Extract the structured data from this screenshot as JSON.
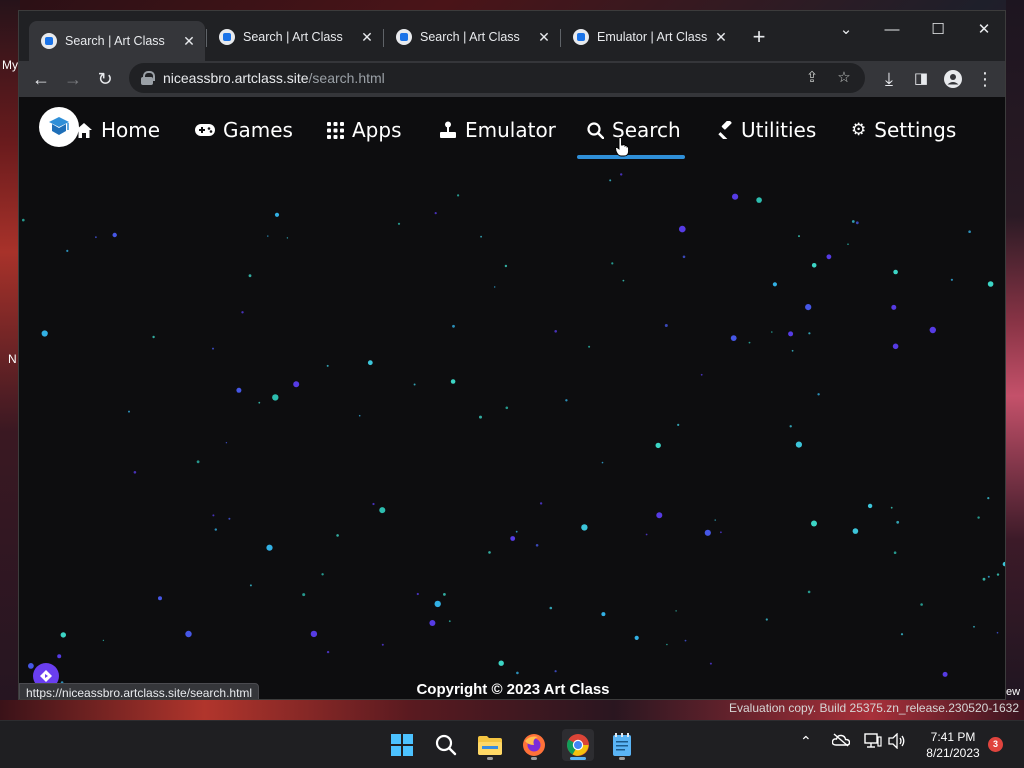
{
  "desktop": {
    "left_label_top": "My",
    "left_label_mid": "N",
    "right_label": "ew",
    "watermark": "Evaluation copy. Build 25375.zn_release.230520-1632"
  },
  "browser": {
    "tabs": [
      {
        "title": "Search | Art Class",
        "active": true
      },
      {
        "title": "Search | Art Class",
        "active": false
      },
      {
        "title": "Search | Art Class",
        "active": false
      },
      {
        "title": "Emulator | Art Class",
        "active": false
      }
    ],
    "url_host": "niceassbro.artclass.site",
    "url_path": "/search.html",
    "status_url": "https://niceassbro.artclass.site/search.html"
  },
  "site": {
    "nav": [
      {
        "label": "Home",
        "icon": "home-icon"
      },
      {
        "label": "Games",
        "icon": "gamepad-icon"
      },
      {
        "label": "Apps",
        "icon": "grid-icon"
      },
      {
        "label": "Emulator",
        "icon": "joystick-icon"
      },
      {
        "label": "Search",
        "icon": "search-icon",
        "active": true
      },
      {
        "label": "Utilities",
        "icon": "hammer-icon"
      },
      {
        "label": "Settings",
        "icon": "gear-icon"
      }
    ],
    "copyright": "Copyright © 2023 Art Class",
    "accent": "#2f8fd8"
  },
  "taskbar": {
    "time": "7:41 PM",
    "date": "8/21/2023",
    "notification_count": "3"
  }
}
